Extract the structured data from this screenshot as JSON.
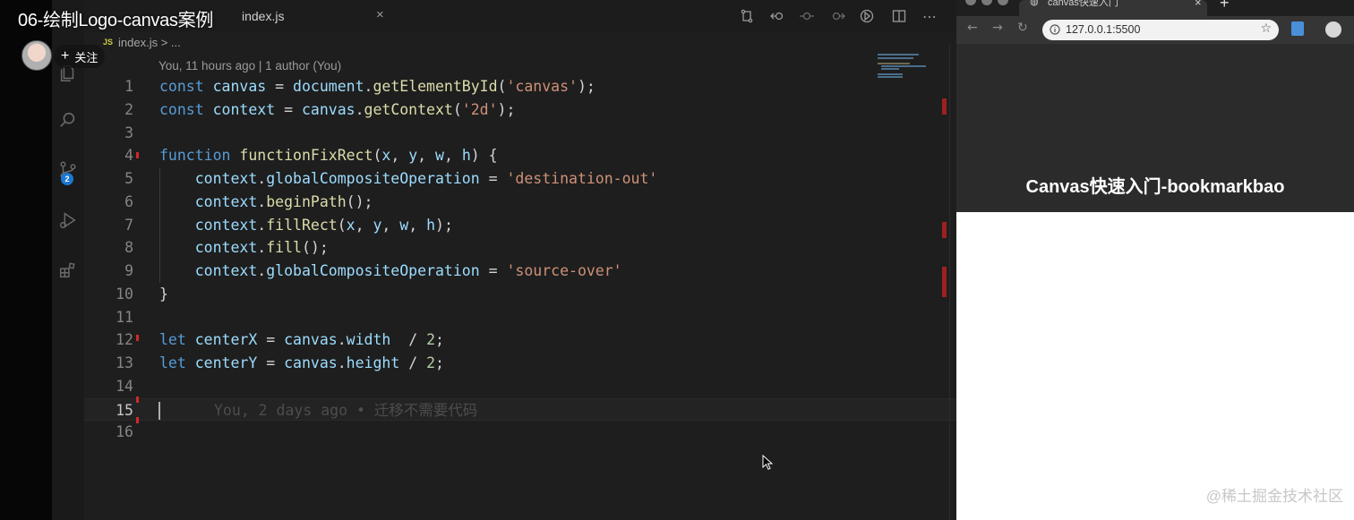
{
  "video": {
    "title": "06-绘制Logo-canvas案例",
    "follow_label": "关注",
    "follow_icon": "plus-icon"
  },
  "editor": {
    "tab": {
      "filename": "index.js",
      "close_glyph": "×"
    },
    "breadcrumb": {
      "lang": "JS",
      "path": "index.js > ..."
    },
    "blame_header": "You, 11 hours ago | 1 author (You)",
    "scm_badge": "2",
    "inline_blame": "You, 2 days ago • 迁移不需要代码",
    "lines": [
      {
        "n": "1",
        "tokens": [
          [
            "kw",
            "const"
          ],
          [
            "pl",
            " "
          ],
          [
            "vr",
            "canvas"
          ],
          [
            "pl",
            " = "
          ],
          [
            "vr",
            "document"
          ],
          [
            "pl",
            "."
          ],
          [
            "fn",
            "getElementById"
          ],
          [
            "pl",
            "("
          ],
          [
            "st",
            "'canvas'"
          ],
          [
            "pl",
            ");"
          ]
        ]
      },
      {
        "n": "2",
        "tokens": [
          [
            "kw",
            "const"
          ],
          [
            "pl",
            " "
          ],
          [
            "vr",
            "context"
          ],
          [
            "pl",
            " = "
          ],
          [
            "vr",
            "canvas"
          ],
          [
            "pl",
            "."
          ],
          [
            "fn",
            "getContext"
          ],
          [
            "pl",
            "("
          ],
          [
            "st",
            "'2d'"
          ],
          [
            "pl",
            ");"
          ]
        ]
      },
      {
        "n": "3",
        "tokens": []
      },
      {
        "n": "4",
        "tokens": [
          [
            "kw",
            "function"
          ],
          [
            "pl",
            " "
          ],
          [
            "fn",
            "functionFixRect"
          ],
          [
            "pl",
            "("
          ],
          [
            "vr",
            "x"
          ],
          [
            "pl",
            ", "
          ],
          [
            "vr",
            "y"
          ],
          [
            "pl",
            ", "
          ],
          [
            "vr",
            "w"
          ],
          [
            "pl",
            ", "
          ],
          [
            "vr",
            "h"
          ],
          [
            "pl",
            ") {"
          ]
        ]
      },
      {
        "n": "5",
        "tokens": [
          [
            "pl",
            "    "
          ],
          [
            "vr",
            "context"
          ],
          [
            "pl",
            "."
          ],
          [
            "vr",
            "globalCompositeOperation"
          ],
          [
            "pl",
            " = "
          ],
          [
            "st",
            "'destination-out'"
          ]
        ]
      },
      {
        "n": "6",
        "tokens": [
          [
            "pl",
            "    "
          ],
          [
            "vr",
            "context"
          ],
          [
            "pl",
            "."
          ],
          [
            "fn",
            "beginPath"
          ],
          [
            "pl",
            "();"
          ]
        ]
      },
      {
        "n": "7",
        "tokens": [
          [
            "pl",
            "    "
          ],
          [
            "vr",
            "context"
          ],
          [
            "pl",
            "."
          ],
          [
            "fn",
            "fillRect"
          ],
          [
            "pl",
            "("
          ],
          [
            "vr",
            "x"
          ],
          [
            "pl",
            ", "
          ],
          [
            "vr",
            "y"
          ],
          [
            "pl",
            ", "
          ],
          [
            "vr",
            "w"
          ],
          [
            "pl",
            ", "
          ],
          [
            "vr",
            "h"
          ],
          [
            "pl",
            ");"
          ]
        ]
      },
      {
        "n": "8",
        "tokens": [
          [
            "pl",
            "    "
          ],
          [
            "vr",
            "context"
          ],
          [
            "pl",
            "."
          ],
          [
            "fn",
            "fill"
          ],
          [
            "pl",
            "();"
          ]
        ]
      },
      {
        "n": "9",
        "tokens": [
          [
            "pl",
            "    "
          ],
          [
            "vr",
            "context"
          ],
          [
            "pl",
            "."
          ],
          [
            "vr",
            "globalCompositeOperation"
          ],
          [
            "pl",
            " = "
          ],
          [
            "st",
            "'source-over'"
          ]
        ]
      },
      {
        "n": "10",
        "tokens": [
          [
            "pl",
            "}"
          ]
        ]
      },
      {
        "n": "11",
        "tokens": []
      },
      {
        "n": "12",
        "tokens": [
          [
            "kw",
            "let"
          ],
          [
            "pl",
            " "
          ],
          [
            "vr",
            "centerX"
          ],
          [
            "pl",
            " = "
          ],
          [
            "vr",
            "canvas"
          ],
          [
            "pl",
            "."
          ],
          [
            "vr",
            "width"
          ],
          [
            "pl",
            "  / "
          ],
          [
            "nm",
            "2"
          ],
          [
            "pl",
            ";"
          ]
        ]
      },
      {
        "n": "13",
        "tokens": [
          [
            "kw",
            "let"
          ],
          [
            "pl",
            " "
          ],
          [
            "vr",
            "centerY"
          ],
          [
            "pl",
            " = "
          ],
          [
            "vr",
            "canvas"
          ],
          [
            "pl",
            "."
          ],
          [
            "vr",
            "height"
          ],
          [
            "pl",
            " / "
          ],
          [
            "nm",
            "2"
          ],
          [
            "pl",
            ";"
          ]
        ]
      },
      {
        "n": "14",
        "tokens": []
      },
      {
        "n": "15",
        "tokens": [],
        "current": true
      },
      {
        "n": "16",
        "tokens": []
      }
    ]
  },
  "browser": {
    "tab_title": "canvas快速入门",
    "tab_close": "×",
    "new_tab": "+",
    "url": "127.0.0.1:5500",
    "heading": "Canvas快速入门-bookmarkbao"
  },
  "watermark": "@稀土掘金技术社区",
  "colors": {
    "keyword": "#569cd6",
    "variable": "#9cdcfe",
    "function": "#dcdcaa",
    "string": "#ce9178",
    "number": "#b5cea8",
    "badge": "#1a78d2"
  }
}
